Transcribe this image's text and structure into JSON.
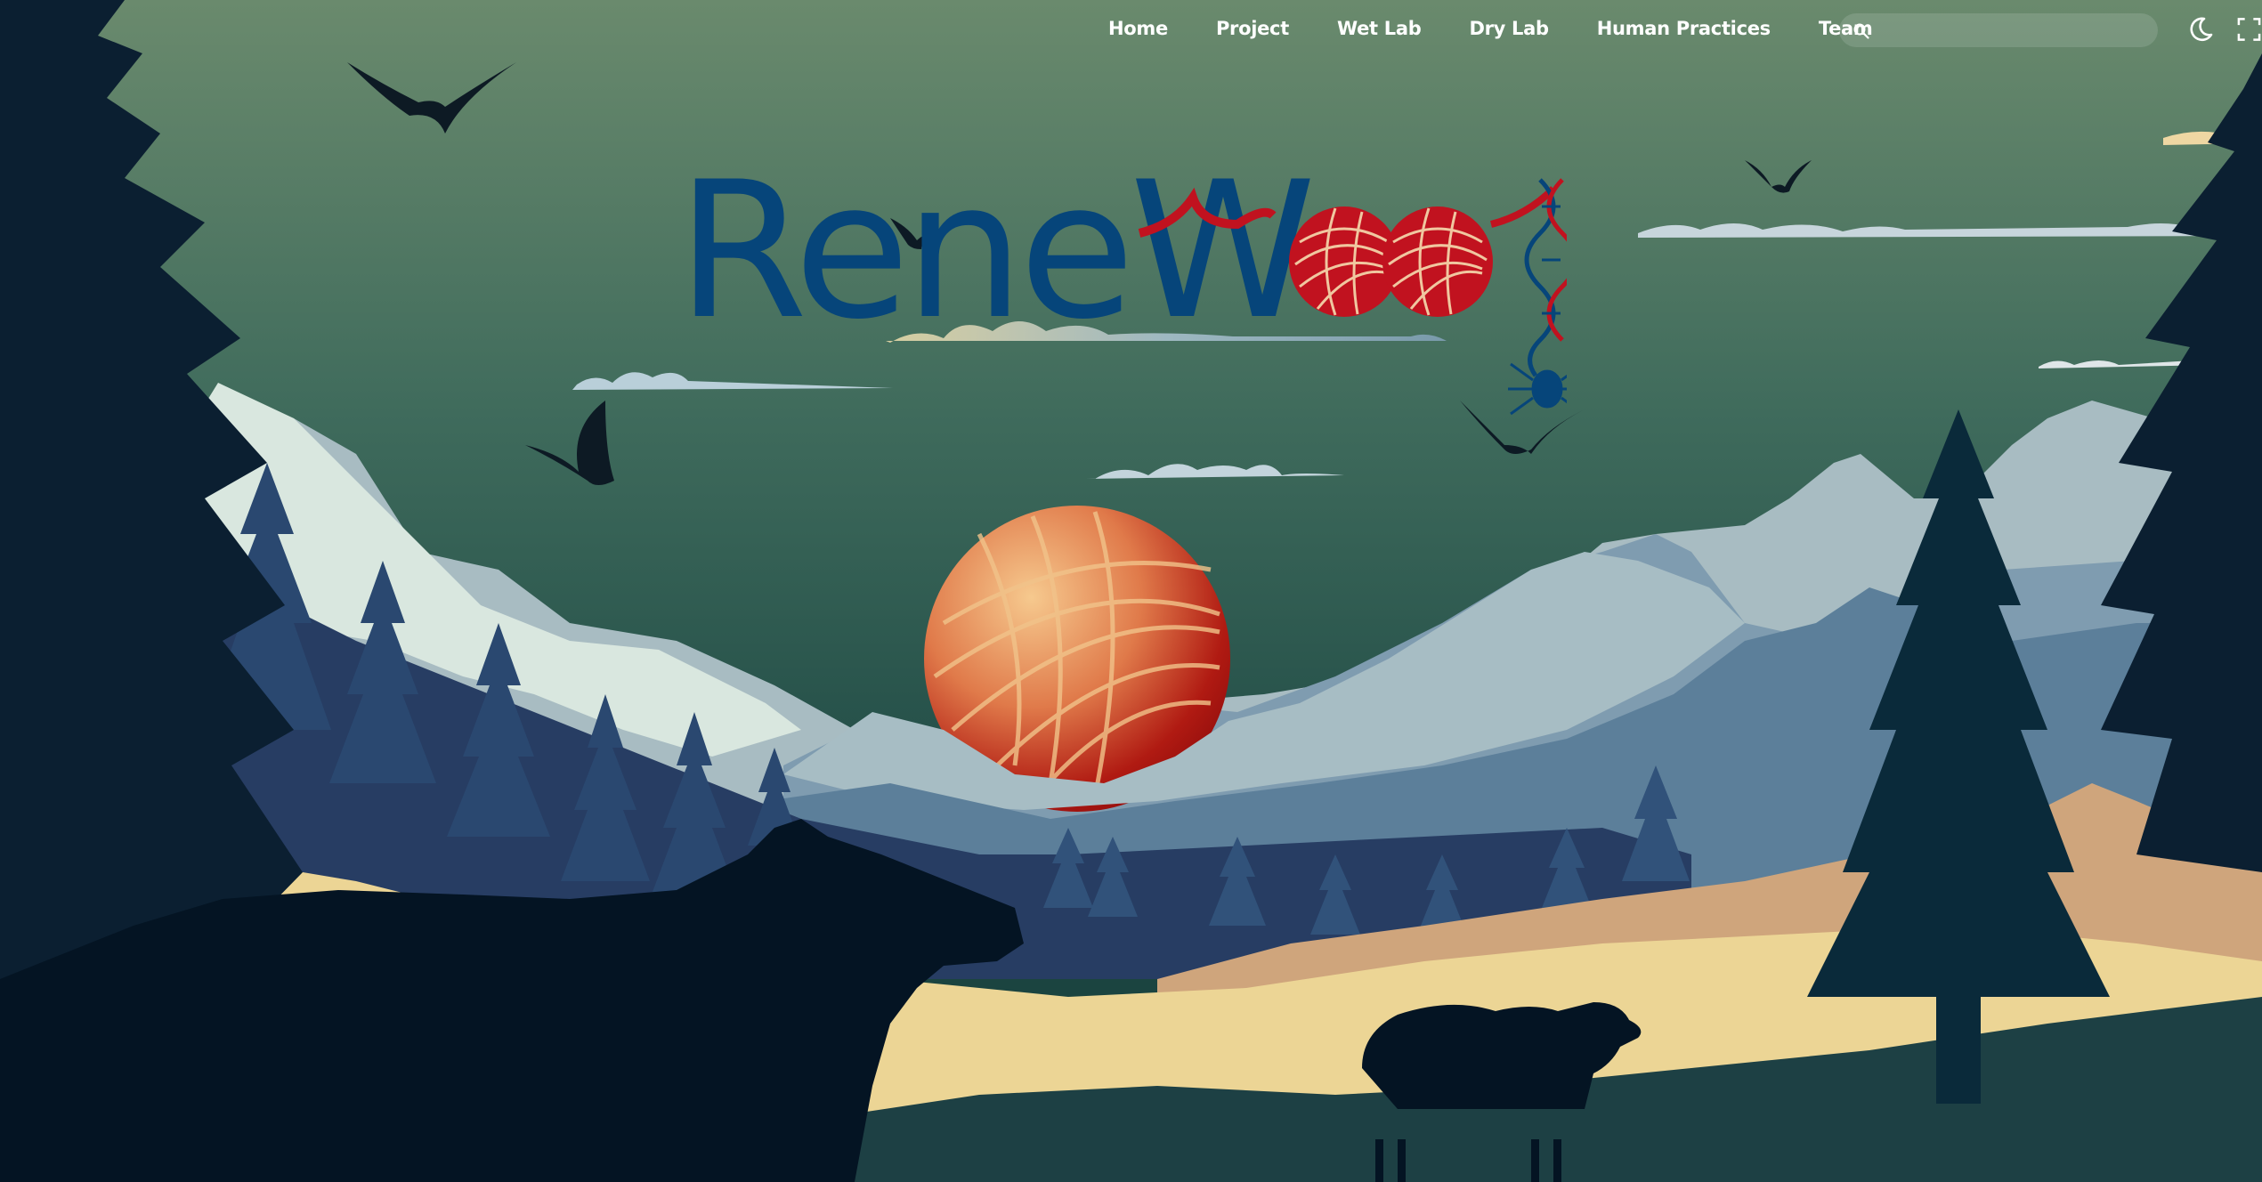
{
  "nav": {
    "items": [
      {
        "label": "Home"
      },
      {
        "label": "Project"
      },
      {
        "label": "Wet Lab"
      },
      {
        "label": "Dry Lab"
      },
      {
        "label": "Human Practices"
      },
      {
        "label": "Team"
      }
    ],
    "search": {
      "placeholder": "",
      "value": ""
    },
    "icons": {
      "search": "search-icon",
      "theme": "moon-icon",
      "fullscreen": "fullscreen-icon"
    }
  },
  "hero": {
    "logo_text": "ReneW",
    "logo_trailing_letters": "oo",
    "logo_final_letter": "l",
    "colors": {
      "logo_blue": "#06457a",
      "yarn_red": "#c1121f",
      "sky_top": "#6b8c6e",
      "sky_bottom": "#1c4640",
      "sun_red": "#a80f0f",
      "meadow": "#ecd595",
      "silhouette": "#041423"
    }
  }
}
